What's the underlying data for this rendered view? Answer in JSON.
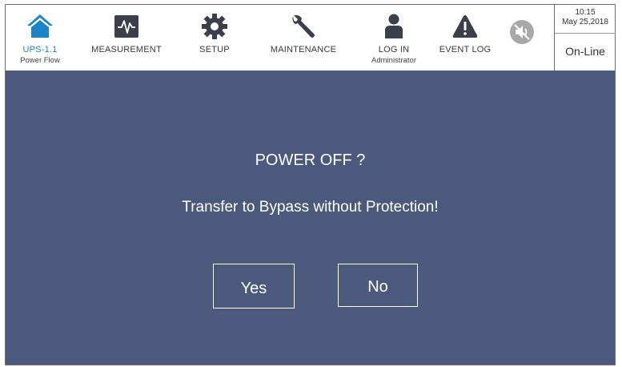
{
  "nav": {
    "power_flow": {
      "label": "UPS-1.1",
      "sub": "Power Flow",
      "icon": "home-icon"
    },
    "measurement": {
      "label": "MEASUREMENT",
      "icon": "waveform-icon"
    },
    "setup": {
      "label": "SETUP",
      "icon": "gear-icon"
    },
    "maintenance": {
      "label": "MAINTENANCE",
      "icon": "wrench-icon"
    },
    "login": {
      "label": "LOG IN",
      "sub": "Administrator",
      "icon": "user-icon"
    },
    "event_log": {
      "label": "EVENT LOG",
      "icon": "warning-icon"
    },
    "mute": {
      "icon": "speaker-muted-icon"
    }
  },
  "status": {
    "time": "10:15",
    "date": "May 25,2018",
    "mode": "On-Line"
  },
  "dialog": {
    "question": "POWER OFF ?",
    "message": "Transfer to Bypass without Protection!",
    "yes_label": "Yes",
    "no_label": "No"
  },
  "colors": {
    "accent": "#1a84c6",
    "panel": "#4b5a7c",
    "icon_dark": "#3a3f4a",
    "mute_grey": "#a8a8a8"
  }
}
